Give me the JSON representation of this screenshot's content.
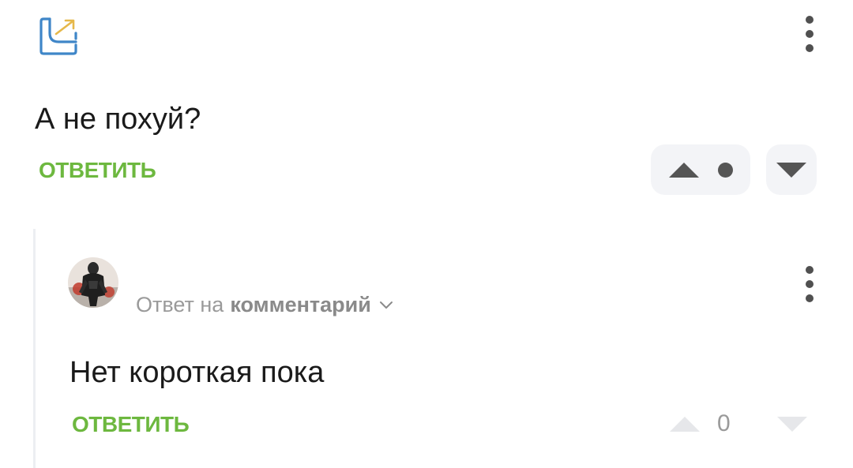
{
  "comment": {
    "logo_icon": "share-arrow-box-icon",
    "menu_icon": "more-vertical-icon",
    "text": "А не похуй?",
    "reply_label": "ОТВЕТИТЬ",
    "vote": {
      "up_icon": "triangle-up-icon",
      "down_icon": "triangle-down-icon",
      "rating_icon": "rating-dot-icon"
    }
  },
  "reply": {
    "avatar_icon": "user-avatar",
    "reply_prefix": "Ответ на",
    "reply_target": "комментарий",
    "chevron_icon": "chevron-down-icon",
    "menu_icon": "more-vertical-icon",
    "text": "Нет короткая пока",
    "reply_label": "ОТВЕТИТЬ",
    "vote": {
      "up_icon": "triangle-up-icon",
      "count": "0",
      "down_icon": "triangle-down-icon"
    }
  },
  "colors": {
    "accent_green": "#6db83f",
    "logo_blue": "#3f86c8",
    "logo_gold": "#e6b84a",
    "icon_dark": "#555555",
    "muted_gray": "#9a9a9a",
    "vote_bg": "#f3f4f7"
  }
}
